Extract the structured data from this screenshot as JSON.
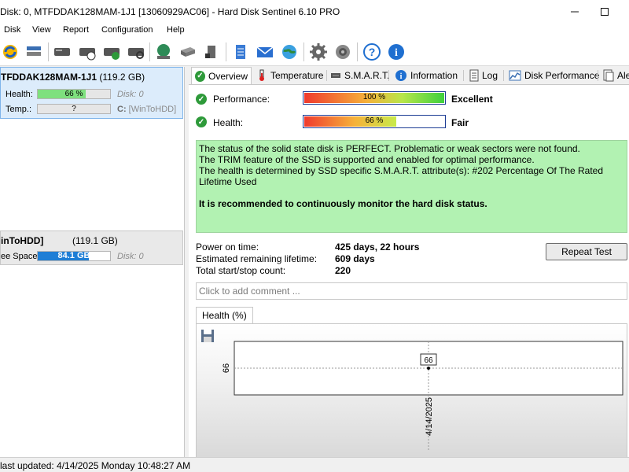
{
  "window": {
    "title": "Disk: 0, MTFDDAK128MAM-1J1 [13060929AC06]  -  Hard Disk Sentinel 6.10 PRO"
  },
  "menu": [
    {
      "label": "Disk",
      "key": "D"
    },
    {
      "label": "View",
      "key": "V"
    },
    {
      "label": "Report",
      "key": "R"
    },
    {
      "label": "Configuration",
      "key": "C"
    },
    {
      "label": "Help",
      "key": "H"
    }
  ],
  "left": {
    "disk": {
      "name": "TFDDAK128MAM-1J1",
      "size": "(119.2 GB)",
      "health_label": "Health:",
      "health_value": "66 %",
      "health_fraction": 0.66,
      "disk_id": "Disk: 0",
      "temp_label": "Temp.:",
      "temp_value": "?",
      "volume_letter": "C:",
      "volume_name": "[WinToHDD]"
    },
    "volume": {
      "name": "inToHDD]",
      "size": "(119.1 GB)",
      "free_label": "ee Space",
      "free_value": "84.1 GB",
      "free_fraction": 0.706,
      "disk_id": "Disk: 0"
    }
  },
  "tabs": [
    {
      "label": "Overview",
      "icon": "check-icon",
      "active": true
    },
    {
      "label": "Temperature",
      "icon": "thermometer-icon"
    },
    {
      "label": "S.M.A.R.T.",
      "icon": "smart-icon"
    },
    {
      "label": "Information",
      "icon": "info-icon"
    },
    {
      "label": "Log",
      "icon": "log-icon"
    },
    {
      "label": "Disk Performance",
      "icon": "performance-icon"
    },
    {
      "label": "Ale",
      "icon": "alerts-icon"
    }
  ],
  "overview": {
    "performance_label": "Performance:",
    "performance_value": "100 %",
    "performance_fraction": 1.0,
    "performance_rating": "Excellent",
    "health_label": "Health:",
    "health_value": "66 %",
    "health_fraction": 0.66,
    "health_rating": "Fair",
    "status_line1": "The status of the solid state disk is PERFECT. Problematic or weak sectors were not found.",
    "status_line2": "The TRIM feature of the SSD is supported and enabled for optimal performance.",
    "status_line3": "The health is determined by SSD specific S.M.A.R.T. attribute(s):  #202 Percentage Of The Rated Lifetime Used",
    "status_recommend": "It is recommended to continuously monitor the hard disk status.",
    "power_on_label": "Power on time:",
    "power_on_value": "425 days, 22 hours",
    "lifetime_label": "Estimated remaining lifetime:",
    "lifetime_value": "609 days",
    "startstop_label": "Total start/stop count:",
    "startstop_value": "220",
    "repeat_button": "Repeat Test",
    "comment_placeholder": "Click to add comment ..."
  },
  "health_graph": {
    "tab_label": "Health (%)",
    "y_tick": "66",
    "x_tick": "4/14/2025",
    "point_label": "66"
  },
  "chart_data": {
    "type": "line",
    "x": [
      "4/14/2025"
    ],
    "series": [
      {
        "values": [
          66
        ]
      }
    ]
  },
  "statusbar": {
    "text": "last updated: 4/14/2025 Monday 10:48:27 AM"
  },
  "colors": {
    "health_fill": "#7ee07e",
    "free_fill": "#1e7ed6",
    "status_bg": "#b2f2b2",
    "selection_bg": "#dcecfb"
  }
}
